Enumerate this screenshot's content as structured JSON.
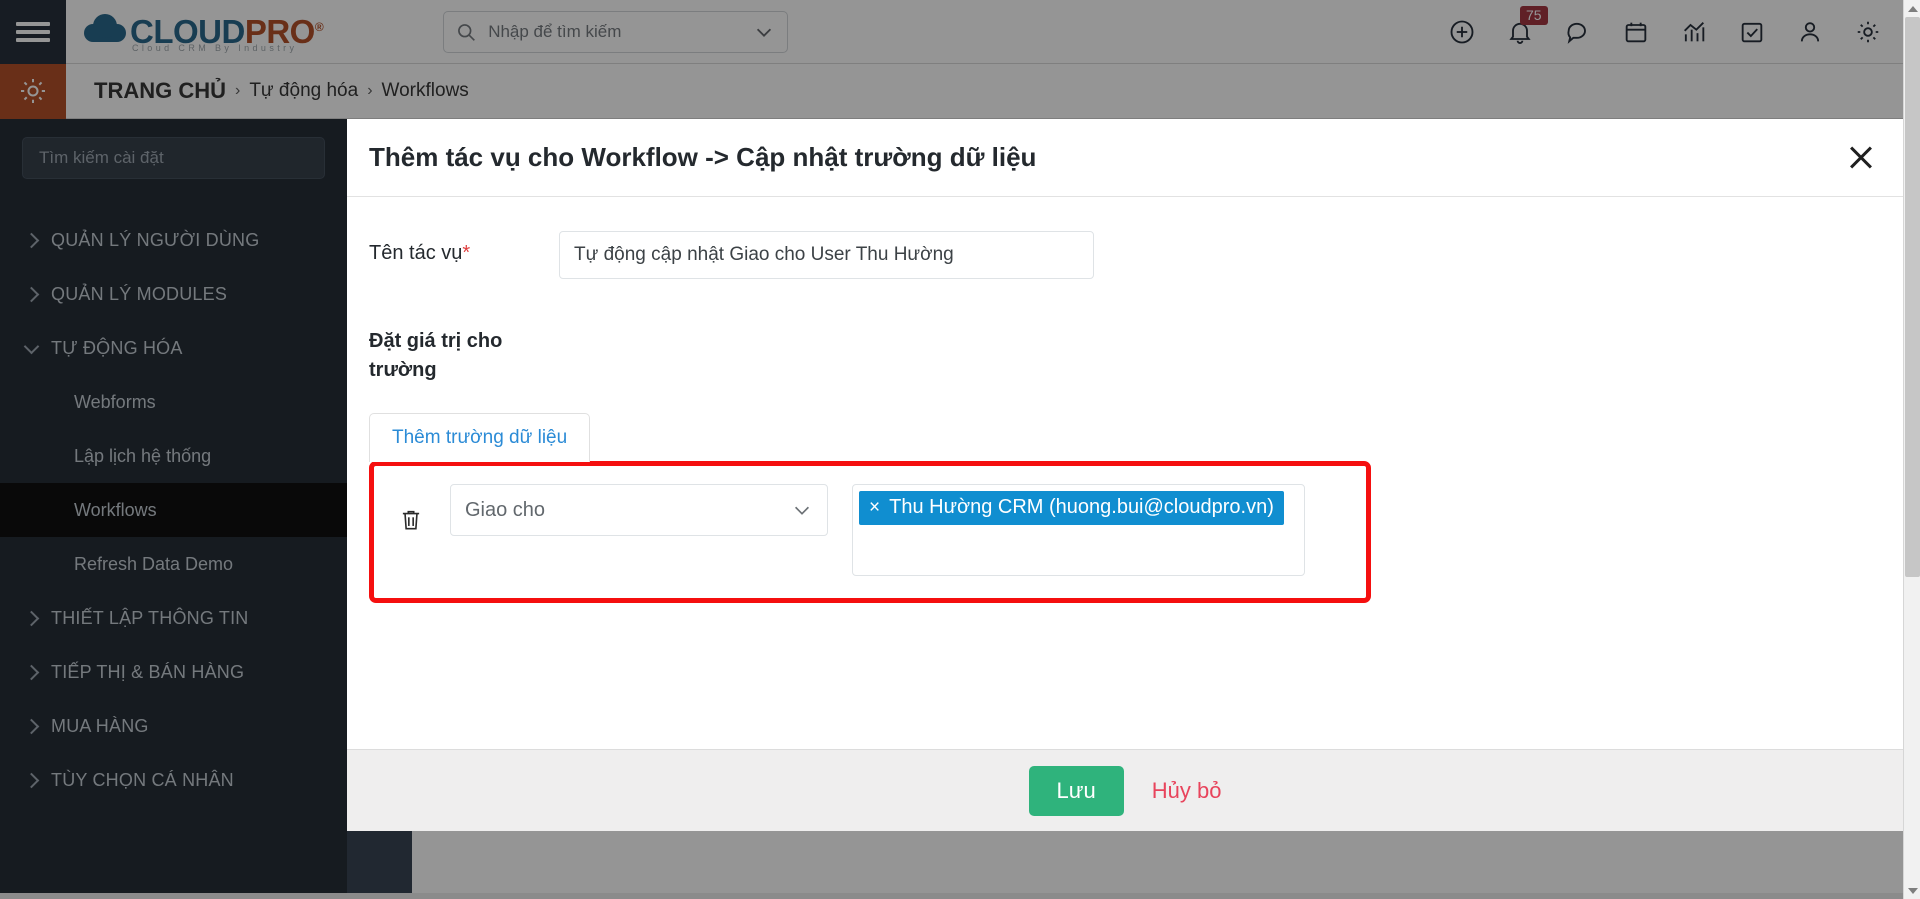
{
  "topbar": {
    "menu_icon": "hamburger-icon",
    "logo": {
      "cloud": "CLOUD",
      "pro": "PRO",
      "reg": "®",
      "tagline": "Cloud CRM By Industry"
    },
    "search": {
      "placeholder": "Nhập để tìm kiếm",
      "icon": "search-icon",
      "chevron": "chevron-down-icon"
    },
    "icons": [
      {
        "name": "add-circle-icon",
        "badge": ""
      },
      {
        "name": "bell-icon",
        "badge": "75"
      },
      {
        "name": "chat-bubble-icon",
        "badge": ""
      },
      {
        "name": "calendar-icon",
        "badge": ""
      },
      {
        "name": "analytics-chart-icon",
        "badge": ""
      },
      {
        "name": "task-checkbox-icon",
        "badge": ""
      },
      {
        "name": "user-icon",
        "badge": ""
      },
      {
        "name": "gear-icon",
        "badge": ""
      }
    ]
  },
  "breadcrumb": {
    "gear_icon": "settings-gear-icon",
    "home": "TRANG CHỦ",
    "sep": "›",
    "items": [
      "Tự động hóa",
      "Workflows"
    ]
  },
  "sidebar": {
    "search_placeholder": "Tìm kiếm cài đặt",
    "items": [
      {
        "label": "QUẢN LÝ NGƯỜI DÙNG",
        "type": "group",
        "expanded": false
      },
      {
        "label": "QUẢN LÝ MODULES",
        "type": "group",
        "expanded": false
      },
      {
        "label": "TỰ ĐỘNG HÓA",
        "type": "group",
        "expanded": true
      },
      {
        "label": "Webforms",
        "type": "sub",
        "active": false
      },
      {
        "label": "Lập lịch hệ thống",
        "type": "sub",
        "active": false
      },
      {
        "label": "Workflows",
        "type": "sub",
        "active": true
      },
      {
        "label": "Refresh Data Demo",
        "type": "sub",
        "active": false
      },
      {
        "label": "THIẾT LẬP THÔNG TIN",
        "type": "group",
        "expanded": false
      },
      {
        "label": "TIẾP THỊ & BÁN HÀNG",
        "type": "group",
        "expanded": false
      },
      {
        "label": "MUA HÀNG",
        "type": "group",
        "expanded": false
      },
      {
        "label": "TÙY CHỌN CÁ NHÂN",
        "type": "group",
        "expanded": false
      }
    ]
  },
  "modal": {
    "title": "Thêm tác vụ cho Workflow -> Cập nhật trường dữ liệu",
    "close_icon": "close-icon",
    "task_name": {
      "label": "Tên tác vụ",
      "required_mark": "*",
      "value": "Tự động cập nhật Giao cho User Thu Hường",
      "placeholder": ""
    },
    "section_label": "Đặt giá trị cho trường",
    "tab_label": "Thêm trường dữ liệu",
    "field_row": {
      "delete_icon": "trash-icon",
      "field_select": {
        "value": "Giao cho",
        "chevron": "chevron-down-icon"
      },
      "value_tag": {
        "remove": "×",
        "label": "Thu Hường CRM (huong.bui@cloudpro.vn)"
      }
    },
    "footer": {
      "save_label": "Lưu",
      "cancel_label": "Hủy bỏ"
    },
    "highlight_color": "#f50f0f",
    "tag_color": "#108ed0",
    "save_color": "#2fb37c",
    "cancel_color": "#e8445c"
  }
}
